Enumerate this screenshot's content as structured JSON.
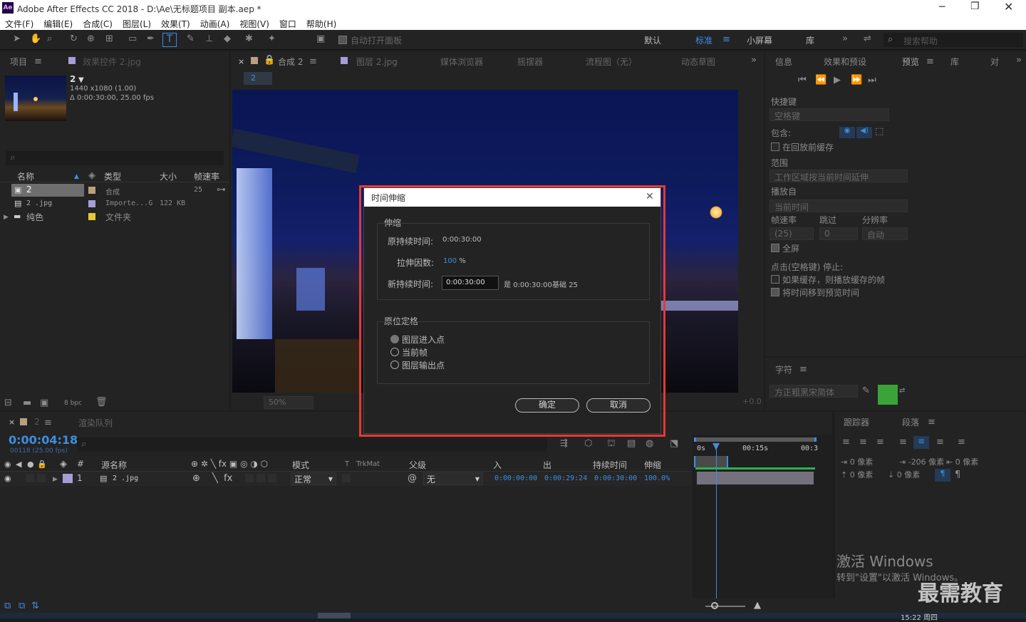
{
  "window": {
    "title": "Adobe After Effects CC 2018 - D:\\Ae\\无标题项目 副本.aep *",
    "app_icon": "Ae"
  },
  "menu": [
    "文件(F)",
    "编辑(E)",
    "合成(C)",
    "图层(L)",
    "效果(T)",
    "动画(A)",
    "视图(V)",
    "窗口",
    "帮助(H)"
  ],
  "toolbar": {
    "auto_open_panel": "自动打开面板",
    "workspaces": [
      "默认",
      "标准",
      "小屏幕",
      "库"
    ],
    "search_help": "搜索帮助"
  },
  "project_panel": {
    "tab_project": "项目",
    "tab_effect_controls": "效果控件 2.jpg",
    "item_name": "2",
    "item_dims": "1440 x1080 (1.00)",
    "item_duration": "Δ 0:00:30:00, 25.00 fps",
    "columns": [
      "名称",
      "类型",
      "大小",
      "帧速率"
    ],
    "rows": [
      {
        "name": "2",
        "type": "合成",
        "size": "",
        "fps": "25",
        "color": "#b9a17c"
      },
      {
        "name": "2 .jpg",
        "type": "Importe...G",
        "size": "122 KB",
        "fps": "",
        "color": "#a59ed6"
      },
      {
        "name": "纯色",
        "type": "文件夹",
        "size": "",
        "fps": "",
        "color": "#e3c93a"
      }
    ],
    "bpc": "8 bpc"
  },
  "comp_panel": {
    "tab_comp": "合成 2",
    "tab_layer": "图层 2.jpg",
    "tab_media": "媒体浏览器",
    "tab_wiggler": "摇摆器",
    "tab_flowchart": "流程图（无）",
    "tab_motion": "动态草图",
    "comp_flag": "2",
    "zoom": "50%",
    "offset": "+0.0"
  },
  "dialog": {
    "title": "时间伸缩",
    "section_stretch": "伸缩",
    "orig_duration_label": "原持续时间:",
    "orig_duration_value": "0:00:30:00",
    "stretch_factor_label": "拉伸因数:",
    "stretch_factor_value": "100",
    "stretch_unit": "%",
    "new_duration_label": "新持续时间:",
    "new_duration_value": "0:00:30:00",
    "is_label": "是",
    "is_value": "0:00:30:00",
    "base_label": "基础",
    "base_value": "25",
    "section_hold": "原位定格",
    "options": [
      "图层进入点",
      "当前帧",
      "图层输出点"
    ],
    "ok": "确定",
    "cancel": "取消"
  },
  "right_panel": {
    "tabs": [
      "信息",
      "效果和预设",
      "预览",
      "库",
      "对"
    ],
    "shortcut_label": "快捷键",
    "shortcut_value": "空格键",
    "include_label": "包含:",
    "cache_before": "在回放前缓存",
    "range_label": "范围",
    "range_value": "工作区域按当前时间延伸",
    "play_from_label": "播放自",
    "play_from_value": "当前时间",
    "fps_label": "帧速率",
    "skip_label": "跳过",
    "res_label": "分辨率",
    "fps_value": "(25)",
    "skip_value": "0",
    "res_value": "自动",
    "fullscreen": "全屏",
    "on_stop": "点击(空格键) 停止:",
    "if_cached": "如果缓存，则播放缓存的帧",
    "move_time": "将时间移到预览时间"
  },
  "character_panel": {
    "tab": "字符",
    "font": "方正粗黑宋简体"
  },
  "para_panel": {
    "tab_tracker": "跟踪器",
    "tab_para": "段落",
    "indent_left": "0 像素",
    "indent_first": "-206 像素",
    "indent_right": "0 像素",
    "space_before": "0 像素",
    "space_after": "0 像素"
  },
  "timeline": {
    "tab_comp": "2",
    "tab_render": "渲染队列",
    "timecode": "0:00:04:18",
    "frame_info": "00118 (25.00 fps)",
    "columns": [
      "#",
      "源名称",
      "模式",
      "T",
      "TrkMat",
      "父级",
      "入",
      "出",
      "持续时间",
      "伸缩"
    ],
    "layer": {
      "num": "1",
      "name": "2 .jpg",
      "mode": "正常",
      "parent": "无",
      "in": "0:00:00:00",
      "out": "0:00:29:24",
      "duration": "0:00:30:00",
      "stretch": "100.0%"
    },
    "ruler": [
      "0s",
      "00:15s",
      "00:3"
    ]
  },
  "watermark": {
    "line1": "激活 Windows",
    "line2": "转到\"设置\"以激活 Windows。",
    "brand": "最需教育"
  },
  "taskbar": {
    "time": "15:22 周四"
  }
}
